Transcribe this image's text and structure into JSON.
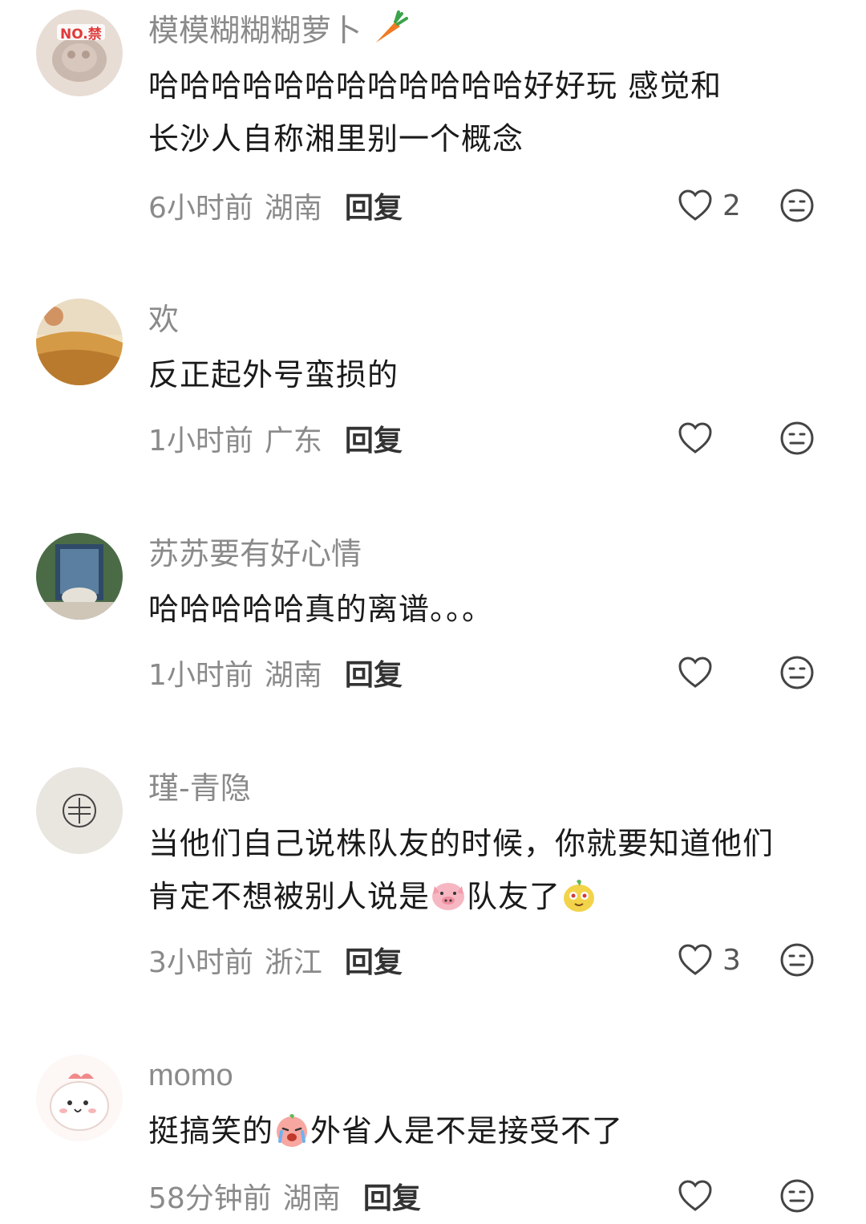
{
  "comments": [
    {
      "username": "模模糊糊糊萝卜",
      "username_suffix_icon": "carrot-emoji",
      "avatar_badge": "NO.禁",
      "text_lines": [
        "哈哈哈哈哈哈哈哈哈哈哈哈好好玩 感觉和",
        "长沙人自称湘里别一个概念"
      ],
      "time": "6小时前",
      "region": "湖南",
      "reply": "回复",
      "likes": "2"
    },
    {
      "username": "欢",
      "text_lines": [
        "反正起外号蛮损的"
      ],
      "time": "1小时前",
      "region": "广东",
      "reply": "回复",
      "likes": ""
    },
    {
      "username": "苏苏要有好心情",
      "text_lines": [
        "哈哈哈哈哈真的离谱。。。"
      ],
      "time": "1小时前",
      "region": "湖南",
      "reply": "回复",
      "likes": ""
    },
    {
      "username": "瑾-青隐",
      "text_line1": "当他们自己说株队友的时候，你就要知道他们",
      "text_line2_a": "肯定不想被别人说是",
      "text_line2_b": "队友了",
      "inline_icons": [
        "pig-emoji",
        "yellow-creature-emoji"
      ],
      "time": "3小时前",
      "region": "浙江",
      "reply": "回复",
      "likes": "3"
    },
    {
      "username": "momo",
      "text_a": "挺搞笑的",
      "text_b": "外省人是不是接受不了",
      "inline_icons": [
        "crying-laugh-emoji"
      ],
      "time": "58分钟前",
      "region": "湖南",
      "reply": "回复",
      "likes": ""
    }
  ],
  "icons": {
    "like": "heart-outline-icon",
    "react": "meh-face-icon"
  },
  "colors": {
    "username": "#8a8a8a",
    "text": "#1a1a1a",
    "meta": "#8a8a8a"
  }
}
